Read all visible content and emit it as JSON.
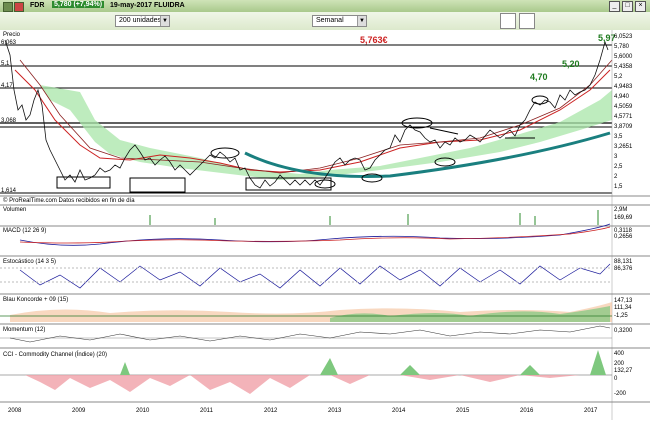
{
  "window": {
    "symbol": "FDR",
    "price_badge": "5,780 (+7,94%)",
    "date_name": "19-may-2017 FLUIDRA"
  },
  "toolbar": {
    "units": "200 unidades",
    "period": "Semanal"
  },
  "status_line": "© ProRealTime.com Datos recibidos en fin de día",
  "panels": {
    "price": {
      "label": "Precio",
      "annotations": [
        "5,763€",
        "5,97",
        "5,20",
        "4,70"
      ],
      "right_axis": [
        "6,0523",
        "5,780",
        "5,6000",
        "5,4358",
        "5,2",
        "4,9483",
        "4,940",
        "4,5059",
        "4,5771",
        "3,8709",
        "3,5",
        "3,2651",
        "3",
        "2,5",
        "2",
        "1,5"
      ],
      "left_labels": [
        "6,063",
        "5,1",
        "4,17",
        "3,068",
        "1,614"
      ]
    },
    "volume": {
      "label": "Volumen",
      "right_axis": [
        "2,9M",
        "169,69"
      ]
    },
    "macd": {
      "label": "MACD (12 26 9)",
      "right_axis": [
        "0,3118",
        "0,2656"
      ]
    },
    "stochastic": {
      "label": "Estocástico (14 3 5)",
      "right_axis": [
        "88,131",
        "86,376"
      ]
    },
    "blau": {
      "label": "Blau Koncorde + 09 (15)",
      "right_axis": [
        "147,13",
        "111,34",
        "-1,25"
      ]
    },
    "momentum": {
      "label": "Momentum (12)",
      "right_axis": [
        "0,3200"
      ]
    },
    "cci": {
      "label": "CCI - Commodity Channel (Índice) (20)",
      "right_axis": [
        "400",
        "200",
        "132,27",
        "0",
        "-200"
      ]
    }
  },
  "x_axis": [
    "2008",
    "2009",
    "2010",
    "2011",
    "2012",
    "2013",
    "2014",
    "2015",
    "2016",
    "2017"
  ],
  "colors": {
    "price_line": "#111111",
    "ema_red": "#cc2222",
    "cloud": "#9fe39f",
    "trend": "#1a7f7f",
    "title_bg": "#b6d29c"
  },
  "icons": [
    "window-icon",
    "refresh-icon",
    "chart-icon",
    "settings-icon"
  ]
}
